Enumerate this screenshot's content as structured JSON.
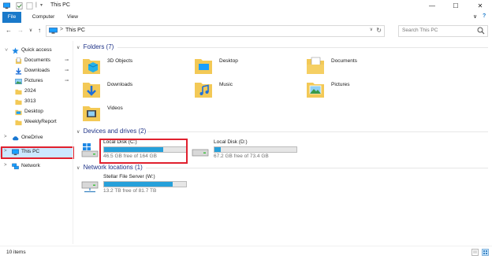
{
  "window": {
    "title": "This PC",
    "minimize_glyph": "—",
    "maximize_glyph": "☐",
    "close_glyph": "✕"
  },
  "ribbon": {
    "tabs": [
      "File",
      "Computer",
      "View"
    ],
    "collapse_glyph": "∨",
    "help_glyph": "?"
  },
  "nav": {
    "back_glyph": "←",
    "forward_glyph": "→",
    "recent_glyph": "∨",
    "up_glyph": "↑",
    "address_sep": ">",
    "address_crumb": "This PC",
    "address_dropdown_glyph": "∨",
    "refresh_glyph": "↻",
    "search_placeholder": "Search This PC"
  },
  "sidebar": {
    "items": [
      {
        "label": "Quick access",
        "icon": "star-icon",
        "chevron": ">",
        "pinned": false
      },
      {
        "label": "Documents",
        "icon": "documents-icon",
        "pinned": true
      },
      {
        "label": "Downloads",
        "icon": "downloads-icon",
        "pinned": true
      },
      {
        "label": "Pictures",
        "icon": "pictures-icon",
        "pinned": true
      },
      {
        "label": "2024",
        "icon": "folder-icon",
        "pinned": false
      },
      {
        "label": "3013",
        "icon": "folder-icon",
        "pinned": false
      },
      {
        "label": "Desktop",
        "icon": "desktop-icon",
        "pinned": false
      },
      {
        "label": "WeeklyReport",
        "icon": "folder-icon",
        "pinned": false
      },
      {
        "label": "OneDrive",
        "icon": "cloud-icon",
        "chevron": ">",
        "pinned": false
      },
      {
        "label": "This PC",
        "icon": "pc-icon",
        "chevron": ">",
        "pinned": false,
        "selected": true
      },
      {
        "label": "Network",
        "icon": "network-icon",
        "chevron": ">",
        "pinned": false
      }
    ],
    "pin_glyph": "📌"
  },
  "content": {
    "folders_header": "Folders (7)",
    "folders": [
      "3D Objects",
      "Desktop",
      "Documents",
      "Downloads",
      "Music",
      "Pictures",
      "Videos"
    ],
    "devices_header": "Devices and drives (2)",
    "drives": [
      {
        "name": "Local Disk (C:)",
        "free": "46.5 GB free of 164 GB",
        "used_fraction": 0.72
      },
      {
        "name": "Local Disk (D:)",
        "free": "67.2 GB free of 73.4 GB",
        "used_fraction": 0.08
      }
    ],
    "network_header": "Network locations (1)",
    "network_drives": [
      {
        "name": "Stellar File Server (W:)",
        "free": "13.2 TB free of 81.7 TB",
        "used_fraction": 0.84
      }
    ],
    "group_chevron": "∨"
  },
  "status": {
    "item_count": "10 items"
  },
  "colors": {
    "accent": "#1979ca",
    "selection": "#cce8ff",
    "drive_bar": "#26a0da",
    "highlight_box": "#e0202e",
    "group_header": "#1e3287"
  }
}
